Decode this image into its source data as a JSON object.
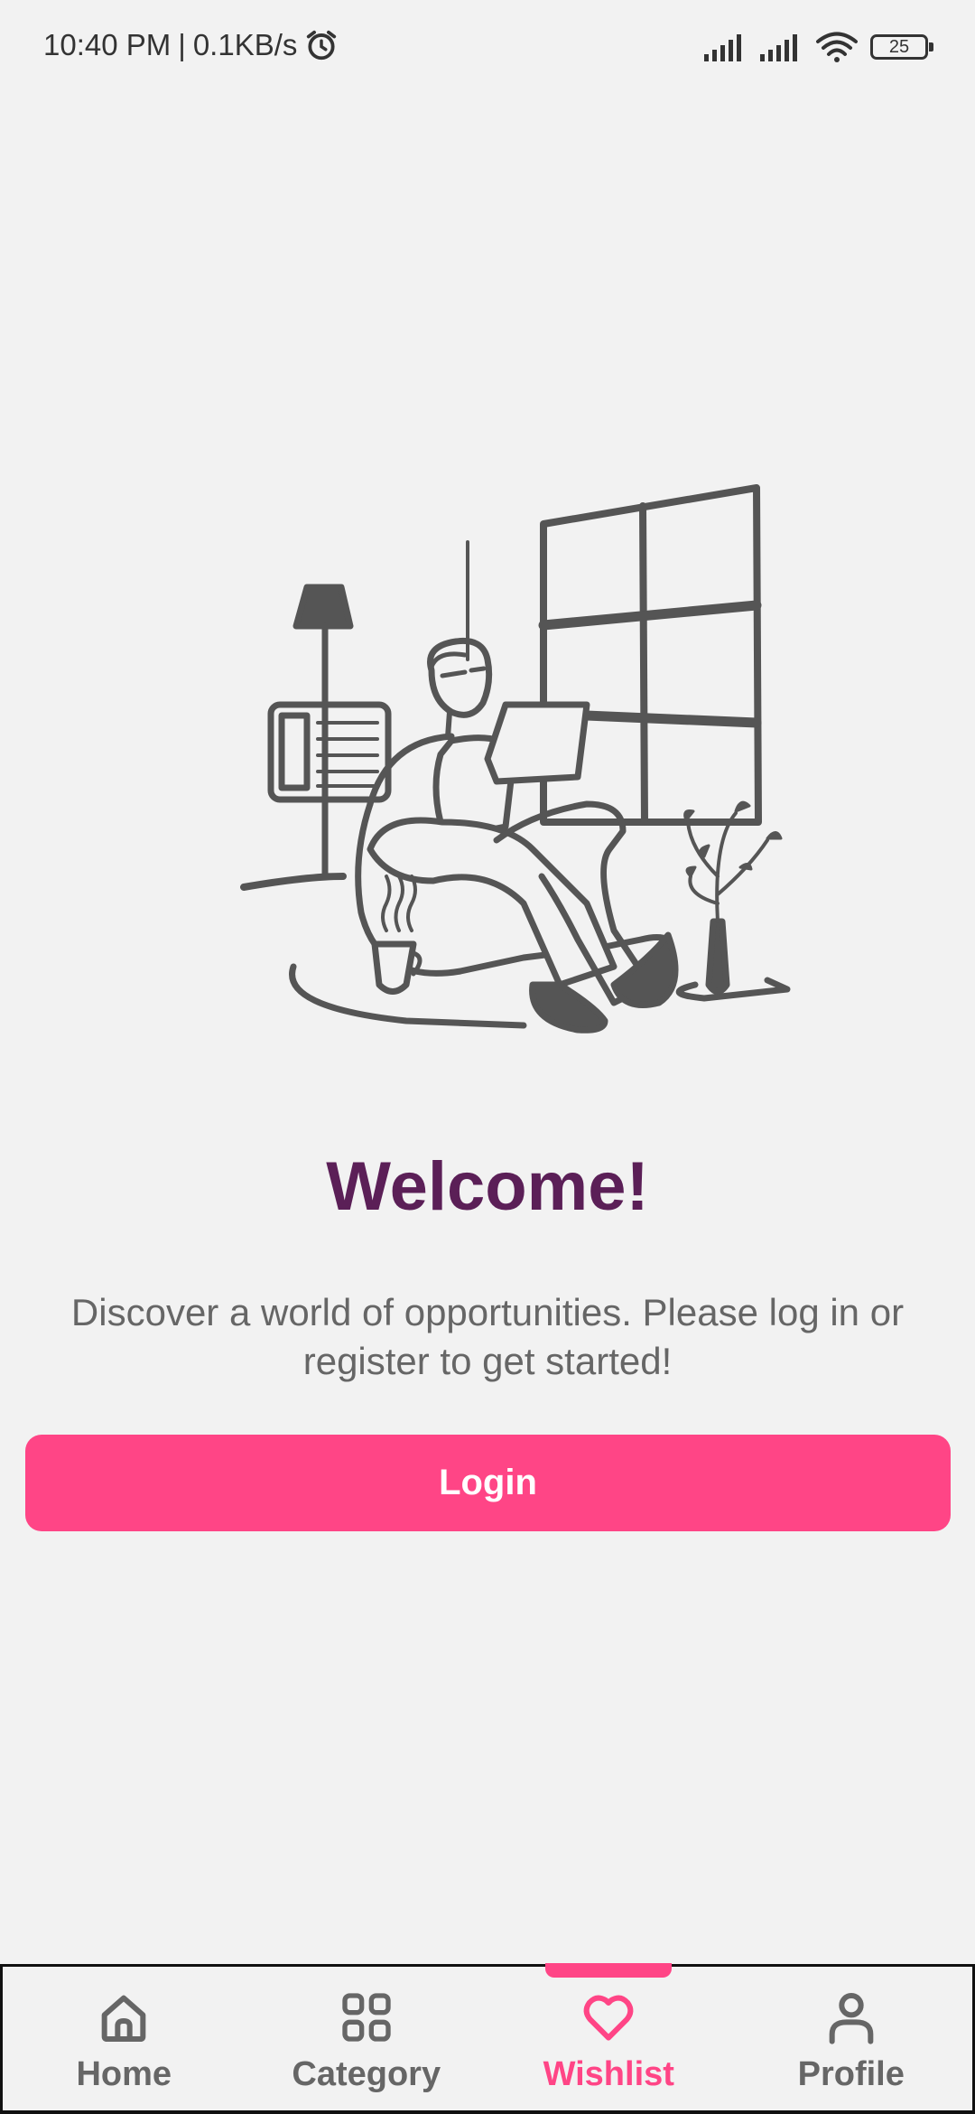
{
  "status_bar": {
    "time": "10:40 PM",
    "separator": "|",
    "network_speed": "0.1KB/s",
    "battery_level": "25",
    "icons": [
      "alarm-icon",
      "signal-icon",
      "signal-icon",
      "wifi-icon",
      "battery-icon"
    ]
  },
  "main": {
    "title": "Welcome!",
    "subtitle": "Discover a world of opportunities. Please log in or register to get started!",
    "login_label": "Login"
  },
  "bottom_nav": {
    "items": [
      {
        "label": "Home",
        "icon": "home-icon"
      },
      {
        "label": "Category",
        "icon": "grid-icon"
      },
      {
        "label": "Wishlist",
        "icon": "heart-icon"
      },
      {
        "label": "Profile",
        "icon": "person-icon"
      }
    ],
    "active_index": 2
  },
  "colors": {
    "background": "#f2f2f2",
    "title": "#5b1f57",
    "accent": "#ff4586",
    "text_secondary": "#666666",
    "illustration": "#555555"
  }
}
